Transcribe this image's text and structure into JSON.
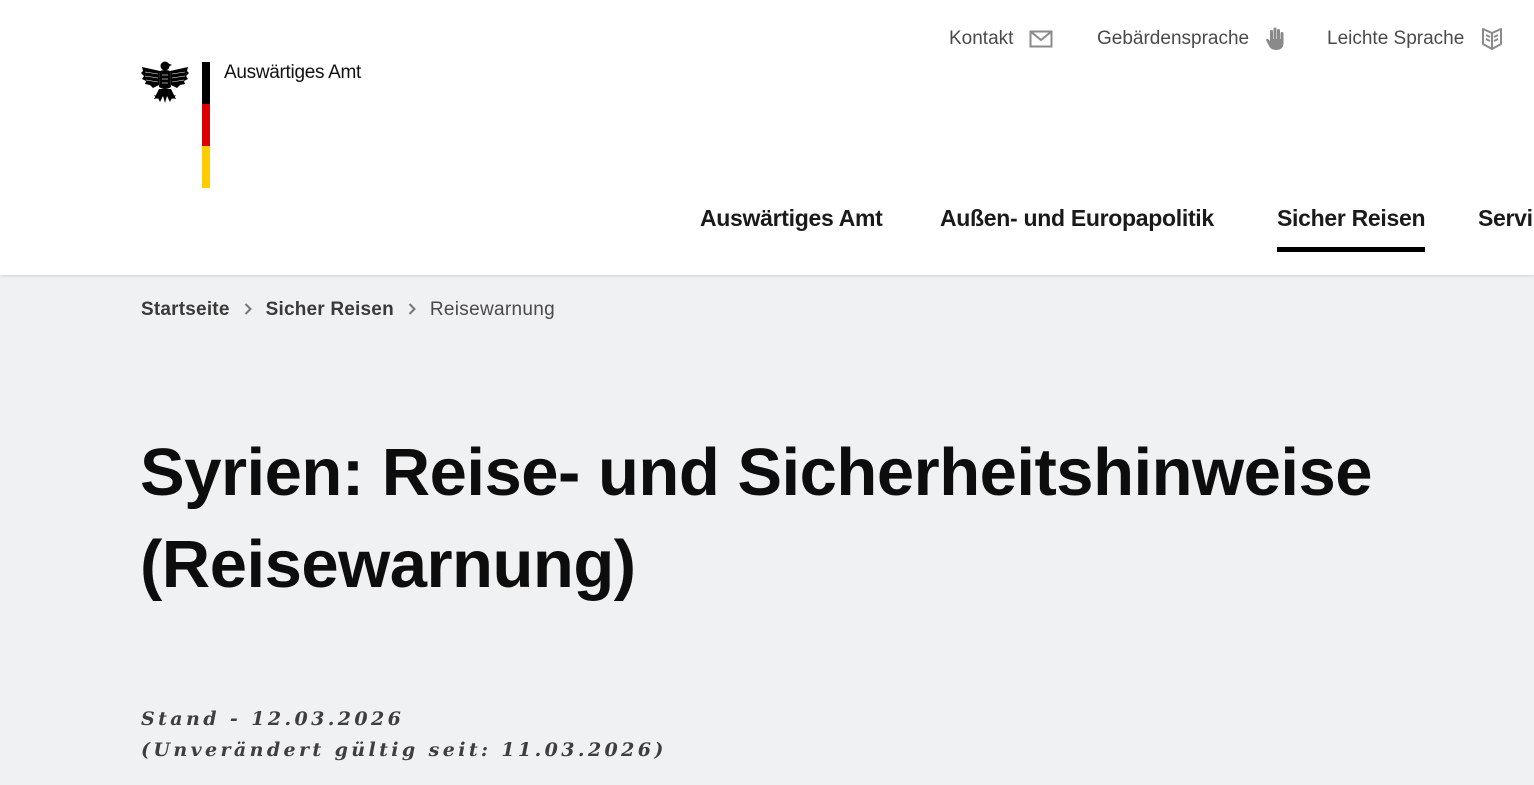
{
  "header": {
    "org_name": "Auswärtiges Amt",
    "flag_colors": [
      "#000000",
      "#dd0000",
      "#ffcc00"
    ],
    "logo_icon": "federal-eagle-icon"
  },
  "service_nav": [
    {
      "label": "Kontakt",
      "icon": "envelope-icon"
    },
    {
      "label": "Gebärdensprache",
      "icon": "hand-icon"
    },
    {
      "label": "Leichte Sprache",
      "icon": "book-icon"
    }
  ],
  "main_nav": [
    {
      "label": "Auswärtiges Amt",
      "active": false
    },
    {
      "label": "Außen- und Europapolitik",
      "active": false
    },
    {
      "label": "Sicher Reisen",
      "active": true
    },
    {
      "label": "Servi",
      "active": false
    }
  ],
  "breadcrumb": {
    "items": [
      "Startseite",
      "Sicher Reisen"
    ],
    "current": "Reisewarnung",
    "separator_icon": "chevron-right-icon"
  },
  "page": {
    "title_line1": "Syrien: Reise- und Sicherheitshinweise",
    "title_line2": "(Reisewarnung)",
    "stand": "Stand - 12.03.2026",
    "valid_since": "(Unverändert gültig seit: 11.03.2026)"
  },
  "colors": {
    "background": "#f0f1f2",
    "header_background": "#ffffff",
    "active_underline": "#000000"
  }
}
